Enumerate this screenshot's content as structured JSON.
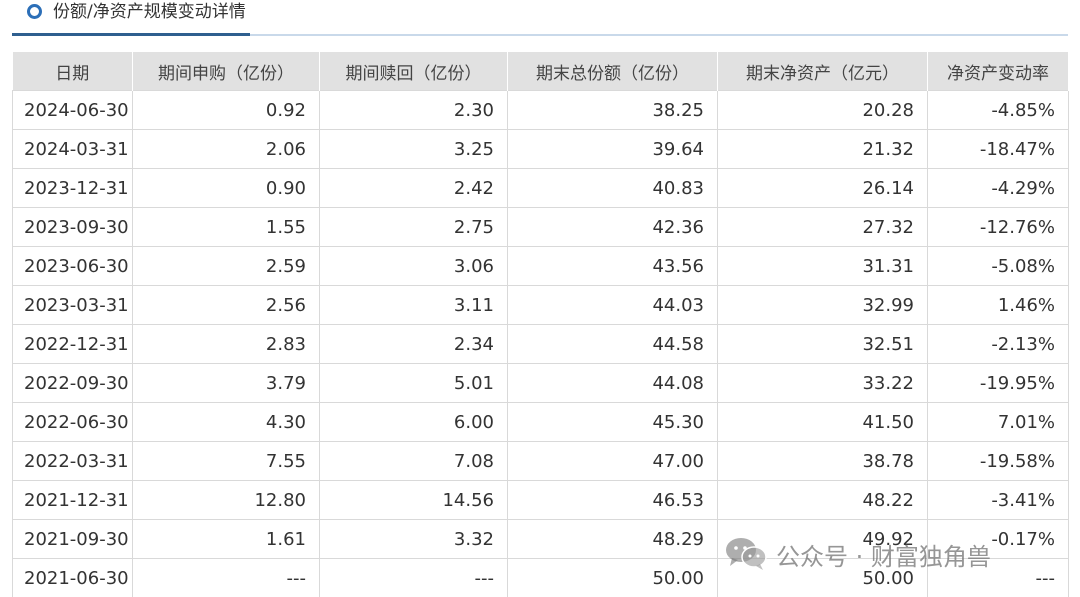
{
  "section": {
    "title": "份额/净资产规模变动详情"
  },
  "table": {
    "headers": [
      "日期",
      "期间申购（亿份）",
      "期间赎回（亿份）",
      "期末总份额（亿份）",
      "期末净资产（亿元）",
      "净资产变动率"
    ],
    "rows": [
      [
        "2024-06-30",
        "0.92",
        "2.30",
        "38.25",
        "20.28",
        "-4.85%"
      ],
      [
        "2024-03-31",
        "2.06",
        "3.25",
        "39.64",
        "21.32",
        "-18.47%"
      ],
      [
        "2023-12-31",
        "0.90",
        "2.42",
        "40.83",
        "26.14",
        "-4.29%"
      ],
      [
        "2023-09-30",
        "1.55",
        "2.75",
        "42.36",
        "27.32",
        "-12.76%"
      ],
      [
        "2023-06-30",
        "2.59",
        "3.06",
        "43.56",
        "31.31",
        "-5.08%"
      ],
      [
        "2023-03-31",
        "2.56",
        "3.11",
        "44.03",
        "32.99",
        "1.46%"
      ],
      [
        "2022-12-31",
        "2.83",
        "2.34",
        "44.58",
        "32.51",
        "-2.13%"
      ],
      [
        "2022-09-30",
        "3.79",
        "5.01",
        "44.08",
        "33.22",
        "-19.95%"
      ],
      [
        "2022-06-30",
        "4.30",
        "6.00",
        "45.30",
        "41.50",
        "7.01%"
      ],
      [
        "2022-03-31",
        "7.55",
        "7.08",
        "47.00",
        "38.78",
        "-19.58%"
      ],
      [
        "2021-12-31",
        "12.80",
        "14.56",
        "46.53",
        "48.22",
        "-3.41%"
      ],
      [
        "2021-09-30",
        "1.61",
        "3.32",
        "48.29",
        "49.92",
        "-0.17%"
      ],
      [
        "2021-06-30",
        "---",
        "---",
        "50.00",
        "50.00",
        "---"
      ]
    ]
  },
  "watermark": {
    "text": "公众号 · 财富独角兽",
    "icon": "wechat-icon"
  },
  "colors": {
    "accent": "#2c6fb8",
    "header_bg": "#e1e1e1",
    "grid": "#d9d9d9"
  }
}
